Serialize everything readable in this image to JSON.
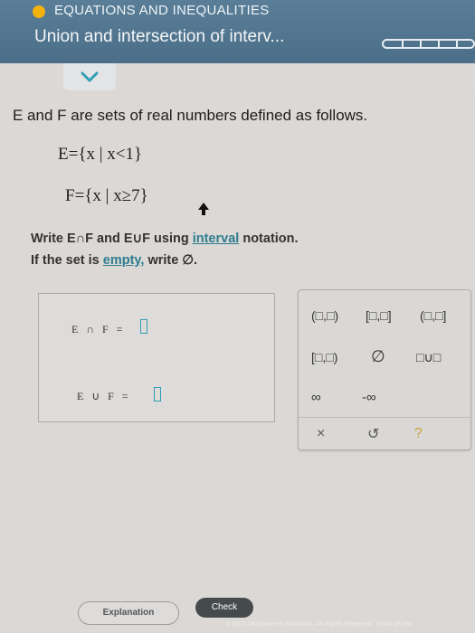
{
  "header": {
    "section": "EQUATIONS AND INEQUALITIES",
    "title": "Union and intersection of interv..."
  },
  "problem": {
    "intro": "E and F are sets of real numbers defined as follows.",
    "set_e": "E={x | x<1}",
    "set_f": "F={x | x≥7}",
    "instr_prefix": "Write E∩F and E∪F using ",
    "instr_link": "interval",
    "instr_suffix": " notation.",
    "empty_prefix": "If the set is ",
    "empty_link": "empty,",
    "empty_suffix": " write ∅."
  },
  "answers": {
    "intersection_label": "E ∩ F =",
    "union_label": "E ∪ F ="
  },
  "palette": {
    "open_open": "(□,□)",
    "closed_closed": "[□,□]",
    "open_closed": "(□,□]",
    "closed_open": "[□,□)",
    "empty_set": "∅",
    "union": "□∪□",
    "infinity": "∞",
    "neg_infinity": "-∞",
    "clear": "×",
    "undo": "↺",
    "help": "?"
  },
  "buttons": {
    "explanation": "Explanation",
    "check": "Check"
  },
  "footer": "© 2020 McGraw-Hill Education. All Rights Reserved.   Terms of Use",
  "colors": {
    "header": "#4b6f88",
    "accent": "#2f9fb4",
    "status_dot": "#f3b30e"
  }
}
